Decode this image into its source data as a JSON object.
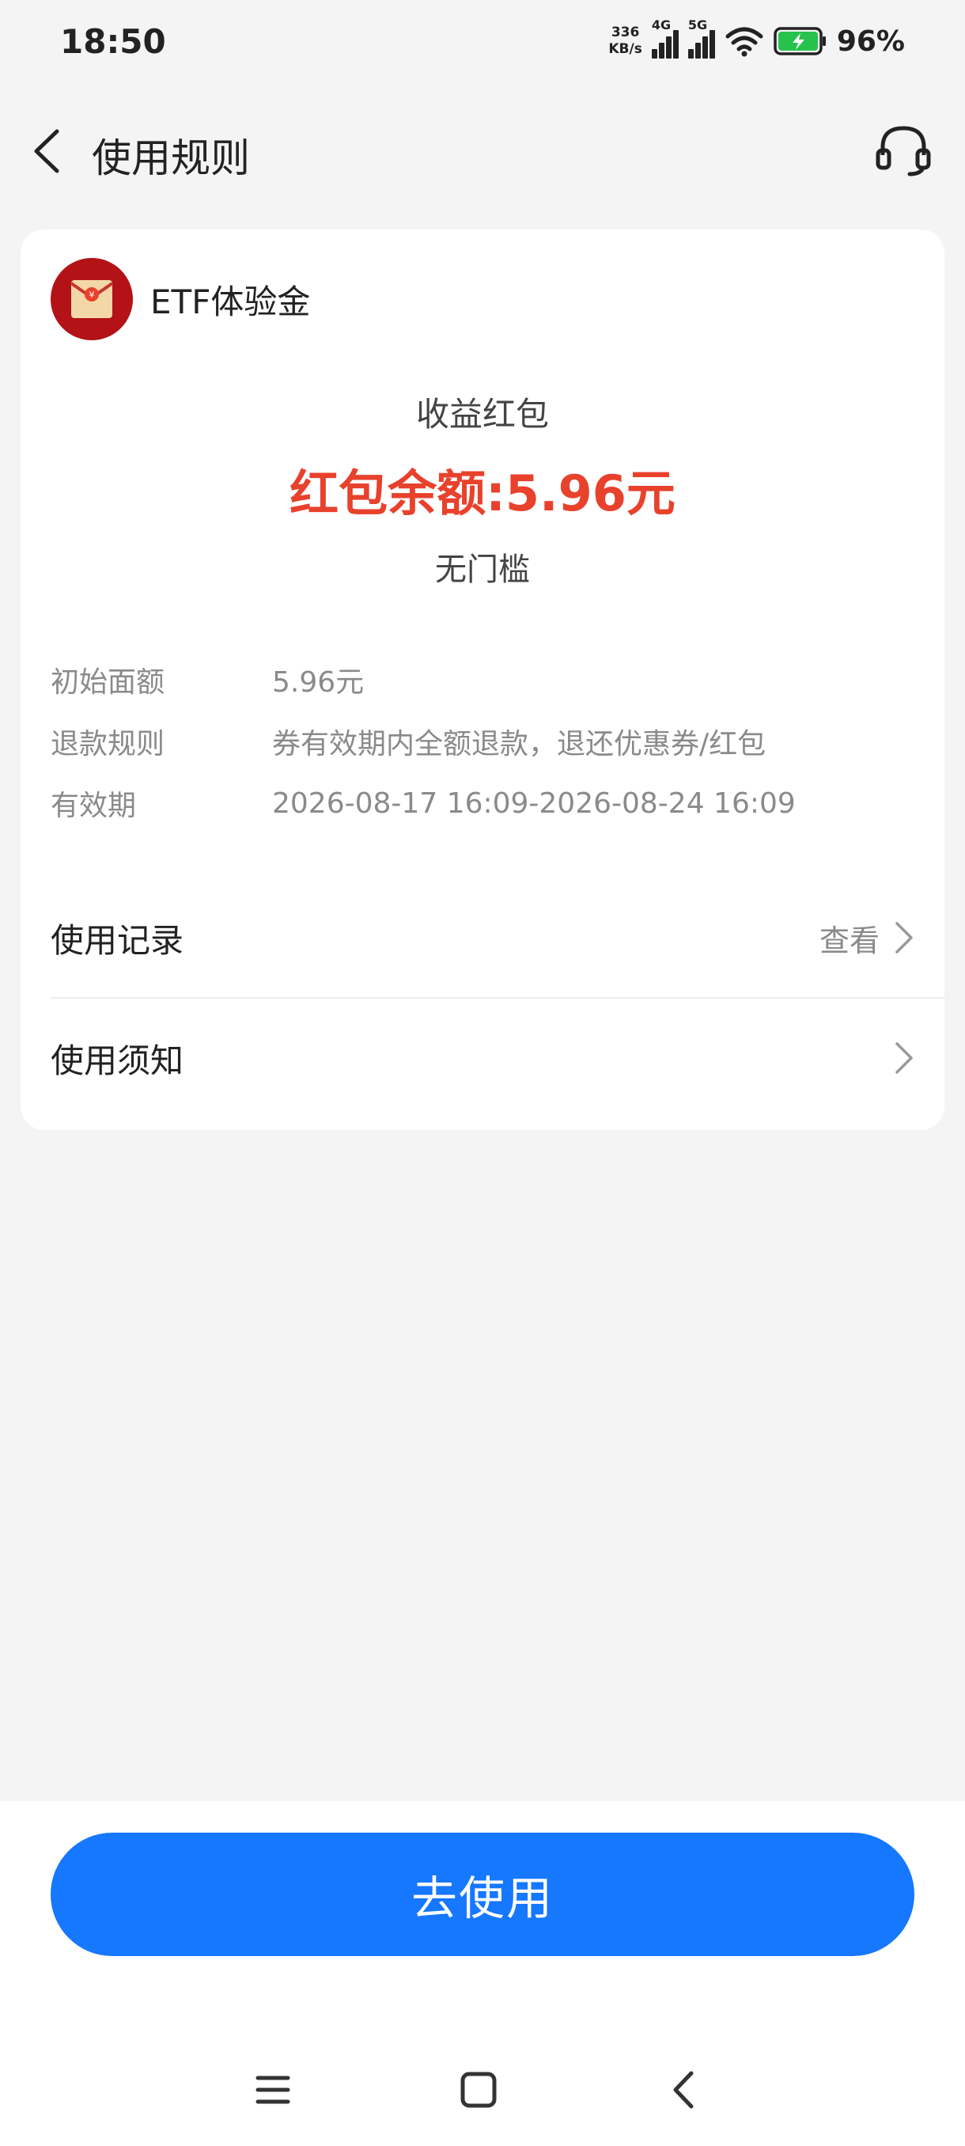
{
  "status_bar": {
    "time": "18:50",
    "net_speed_value": "336",
    "net_speed_unit": "KB/s",
    "signal_1_label": "4G",
    "signal_2_label": "5G",
    "battery_percent": "96%"
  },
  "header": {
    "title": "使用规则",
    "icons": {
      "back": "chevron-left-icon",
      "service": "headset-icon"
    }
  },
  "card": {
    "title": "ETF体验金",
    "coupon_type": "收益红包",
    "balance_text": "红包余额:5.96元",
    "threshold_text": "无门槛",
    "details": [
      {
        "label": "初始面额",
        "value": "5.96元"
      },
      {
        "label": "退款规则",
        "value": "券有效期内全额退款，退还优惠券/红包"
      },
      {
        "label": "有效期",
        "value": "2026-08-17 16:09-2026-08-24 16:09"
      }
    ],
    "usage_record": {
      "label": "使用记录",
      "hint": "查看"
    },
    "usage_notice": {
      "label": "使用须知"
    }
  },
  "footer": {
    "use_button_label": "去使用"
  },
  "colors": {
    "accent_red": "#e8412c",
    "primary_blue": "#1677ff",
    "envelope_red": "#b31217"
  }
}
